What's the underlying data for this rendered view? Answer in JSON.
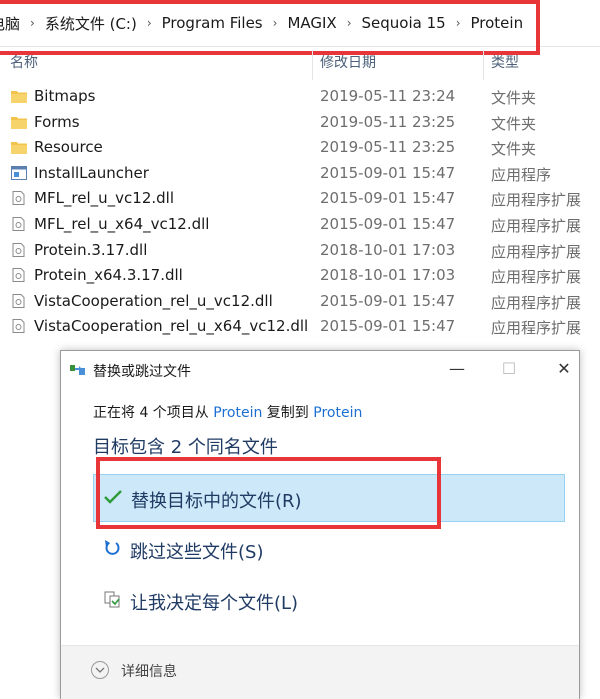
{
  "breadcrumb": {
    "items": [
      "电脑",
      "系统文件 (C:)",
      "Program Files",
      "MAGIX",
      "Sequoia 15",
      "Protein"
    ],
    "separator": "›"
  },
  "columns": {
    "name": "名称",
    "date": "修改日期",
    "type": "类型"
  },
  "files": [
    {
      "name": "Bitmaps",
      "date": "2019-05-11 23:24",
      "type": "文件夹",
      "icon": "folder-icon"
    },
    {
      "name": "Forms",
      "date": "2019-05-11 23:25",
      "type": "文件夹",
      "icon": "folder-icon"
    },
    {
      "name": "Resource",
      "date": "2019-05-11 23:25",
      "type": "文件夹",
      "icon": "folder-icon"
    },
    {
      "name": "InstallLauncher",
      "date": "2015-09-01 15:47",
      "type": "应用程序",
      "icon": "application-icon"
    },
    {
      "name": "MFL_rel_u_vc12.dll",
      "date": "2015-09-01 15:47",
      "type": "应用程序扩展",
      "icon": "dll-file-icon"
    },
    {
      "name": "MFL_rel_u_x64_vc12.dll",
      "date": "2015-09-01 15:47",
      "type": "应用程序扩展",
      "icon": "dll-file-icon"
    },
    {
      "name": "Protein.3.17.dll",
      "date": "2018-10-01 17:03",
      "type": "应用程序扩展",
      "icon": "dll-file-icon"
    },
    {
      "name": "Protein_x64.3.17.dll",
      "date": "2018-10-01 17:03",
      "type": "应用程序扩展",
      "icon": "dll-file-icon"
    },
    {
      "name": "VistaCooperation_rel_u_vc12.dll",
      "date": "2015-09-01 15:47",
      "type": "应用程序扩展",
      "icon": "dll-file-icon"
    },
    {
      "name": "VistaCooperation_rel_u_x64_vc12.dll",
      "date": "2015-09-01 15:47",
      "type": "应用程序扩展",
      "icon": "dll-file-icon"
    }
  ],
  "dialog": {
    "title": "替换或跳过文件",
    "status": {
      "prefix": "正在将 4 个项目从 ",
      "source": "Protein",
      "middle": " 复制到 ",
      "target": "Protein"
    },
    "heading": "目标包含 2 个同名文件",
    "options": {
      "replace": "替换目标中的文件(R)",
      "skip": "跳过这些文件(S)",
      "decide": "让我决定每个文件(L)"
    },
    "details": "详细信息"
  },
  "colors": {
    "highlight_red": "#e8353a",
    "link_blue": "#1c6fd1",
    "selection_bg": "#cde8f8",
    "folder_yellow": "#f2c44d",
    "check_green": "#2e9b3a"
  }
}
